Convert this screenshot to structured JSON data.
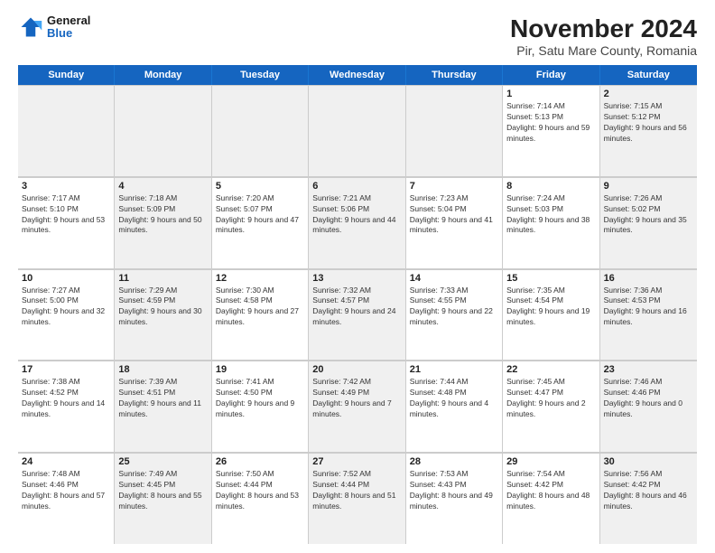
{
  "logo": {
    "line1": "General",
    "line2": "Blue"
  },
  "title": "November 2024",
  "subtitle": "Pir, Satu Mare County, Romania",
  "header_days": [
    "Sunday",
    "Monday",
    "Tuesday",
    "Wednesday",
    "Thursday",
    "Friday",
    "Saturday"
  ],
  "weeks": [
    [
      {
        "day": "",
        "detail": "",
        "shaded": true
      },
      {
        "day": "",
        "detail": "",
        "shaded": true
      },
      {
        "day": "",
        "detail": "",
        "shaded": true
      },
      {
        "day": "",
        "detail": "",
        "shaded": true
      },
      {
        "day": "",
        "detail": "",
        "shaded": true
      },
      {
        "day": "1",
        "detail": "Sunrise: 7:14 AM\nSunset: 5:13 PM\nDaylight: 9 hours and 59 minutes.",
        "shaded": false
      },
      {
        "day": "2",
        "detail": "Sunrise: 7:15 AM\nSunset: 5:12 PM\nDaylight: 9 hours and 56 minutes.",
        "shaded": true
      }
    ],
    [
      {
        "day": "3",
        "detail": "Sunrise: 7:17 AM\nSunset: 5:10 PM\nDaylight: 9 hours and 53 minutes.",
        "shaded": false
      },
      {
        "day": "4",
        "detail": "Sunrise: 7:18 AM\nSunset: 5:09 PM\nDaylight: 9 hours and 50 minutes.",
        "shaded": true
      },
      {
        "day": "5",
        "detail": "Sunrise: 7:20 AM\nSunset: 5:07 PM\nDaylight: 9 hours and 47 minutes.",
        "shaded": false
      },
      {
        "day": "6",
        "detail": "Sunrise: 7:21 AM\nSunset: 5:06 PM\nDaylight: 9 hours and 44 minutes.",
        "shaded": true
      },
      {
        "day": "7",
        "detail": "Sunrise: 7:23 AM\nSunset: 5:04 PM\nDaylight: 9 hours and 41 minutes.",
        "shaded": false
      },
      {
        "day": "8",
        "detail": "Sunrise: 7:24 AM\nSunset: 5:03 PM\nDaylight: 9 hours and 38 minutes.",
        "shaded": false
      },
      {
        "day": "9",
        "detail": "Sunrise: 7:26 AM\nSunset: 5:02 PM\nDaylight: 9 hours and 35 minutes.",
        "shaded": true
      }
    ],
    [
      {
        "day": "10",
        "detail": "Sunrise: 7:27 AM\nSunset: 5:00 PM\nDaylight: 9 hours and 32 minutes.",
        "shaded": false
      },
      {
        "day": "11",
        "detail": "Sunrise: 7:29 AM\nSunset: 4:59 PM\nDaylight: 9 hours and 30 minutes.",
        "shaded": true
      },
      {
        "day": "12",
        "detail": "Sunrise: 7:30 AM\nSunset: 4:58 PM\nDaylight: 9 hours and 27 minutes.",
        "shaded": false
      },
      {
        "day": "13",
        "detail": "Sunrise: 7:32 AM\nSunset: 4:57 PM\nDaylight: 9 hours and 24 minutes.",
        "shaded": true
      },
      {
        "day": "14",
        "detail": "Sunrise: 7:33 AM\nSunset: 4:55 PM\nDaylight: 9 hours and 22 minutes.",
        "shaded": false
      },
      {
        "day": "15",
        "detail": "Sunrise: 7:35 AM\nSunset: 4:54 PM\nDaylight: 9 hours and 19 minutes.",
        "shaded": false
      },
      {
        "day": "16",
        "detail": "Sunrise: 7:36 AM\nSunset: 4:53 PM\nDaylight: 9 hours and 16 minutes.",
        "shaded": true
      }
    ],
    [
      {
        "day": "17",
        "detail": "Sunrise: 7:38 AM\nSunset: 4:52 PM\nDaylight: 9 hours and 14 minutes.",
        "shaded": false
      },
      {
        "day": "18",
        "detail": "Sunrise: 7:39 AM\nSunset: 4:51 PM\nDaylight: 9 hours and 11 minutes.",
        "shaded": true
      },
      {
        "day": "19",
        "detail": "Sunrise: 7:41 AM\nSunset: 4:50 PM\nDaylight: 9 hours and 9 minutes.",
        "shaded": false
      },
      {
        "day": "20",
        "detail": "Sunrise: 7:42 AM\nSunset: 4:49 PM\nDaylight: 9 hours and 7 minutes.",
        "shaded": true
      },
      {
        "day": "21",
        "detail": "Sunrise: 7:44 AM\nSunset: 4:48 PM\nDaylight: 9 hours and 4 minutes.",
        "shaded": false
      },
      {
        "day": "22",
        "detail": "Sunrise: 7:45 AM\nSunset: 4:47 PM\nDaylight: 9 hours and 2 minutes.",
        "shaded": false
      },
      {
        "day": "23",
        "detail": "Sunrise: 7:46 AM\nSunset: 4:46 PM\nDaylight: 9 hours and 0 minutes.",
        "shaded": true
      }
    ],
    [
      {
        "day": "24",
        "detail": "Sunrise: 7:48 AM\nSunset: 4:46 PM\nDaylight: 8 hours and 57 minutes.",
        "shaded": false
      },
      {
        "day": "25",
        "detail": "Sunrise: 7:49 AM\nSunset: 4:45 PM\nDaylight: 8 hours and 55 minutes.",
        "shaded": true
      },
      {
        "day": "26",
        "detail": "Sunrise: 7:50 AM\nSunset: 4:44 PM\nDaylight: 8 hours and 53 minutes.",
        "shaded": false
      },
      {
        "day": "27",
        "detail": "Sunrise: 7:52 AM\nSunset: 4:44 PM\nDaylight: 8 hours and 51 minutes.",
        "shaded": true
      },
      {
        "day": "28",
        "detail": "Sunrise: 7:53 AM\nSunset: 4:43 PM\nDaylight: 8 hours and 49 minutes.",
        "shaded": false
      },
      {
        "day": "29",
        "detail": "Sunrise: 7:54 AM\nSunset: 4:42 PM\nDaylight: 8 hours and 48 minutes.",
        "shaded": false
      },
      {
        "day": "30",
        "detail": "Sunrise: 7:56 AM\nSunset: 4:42 PM\nDaylight: 8 hours and 46 minutes.",
        "shaded": true
      }
    ]
  ]
}
